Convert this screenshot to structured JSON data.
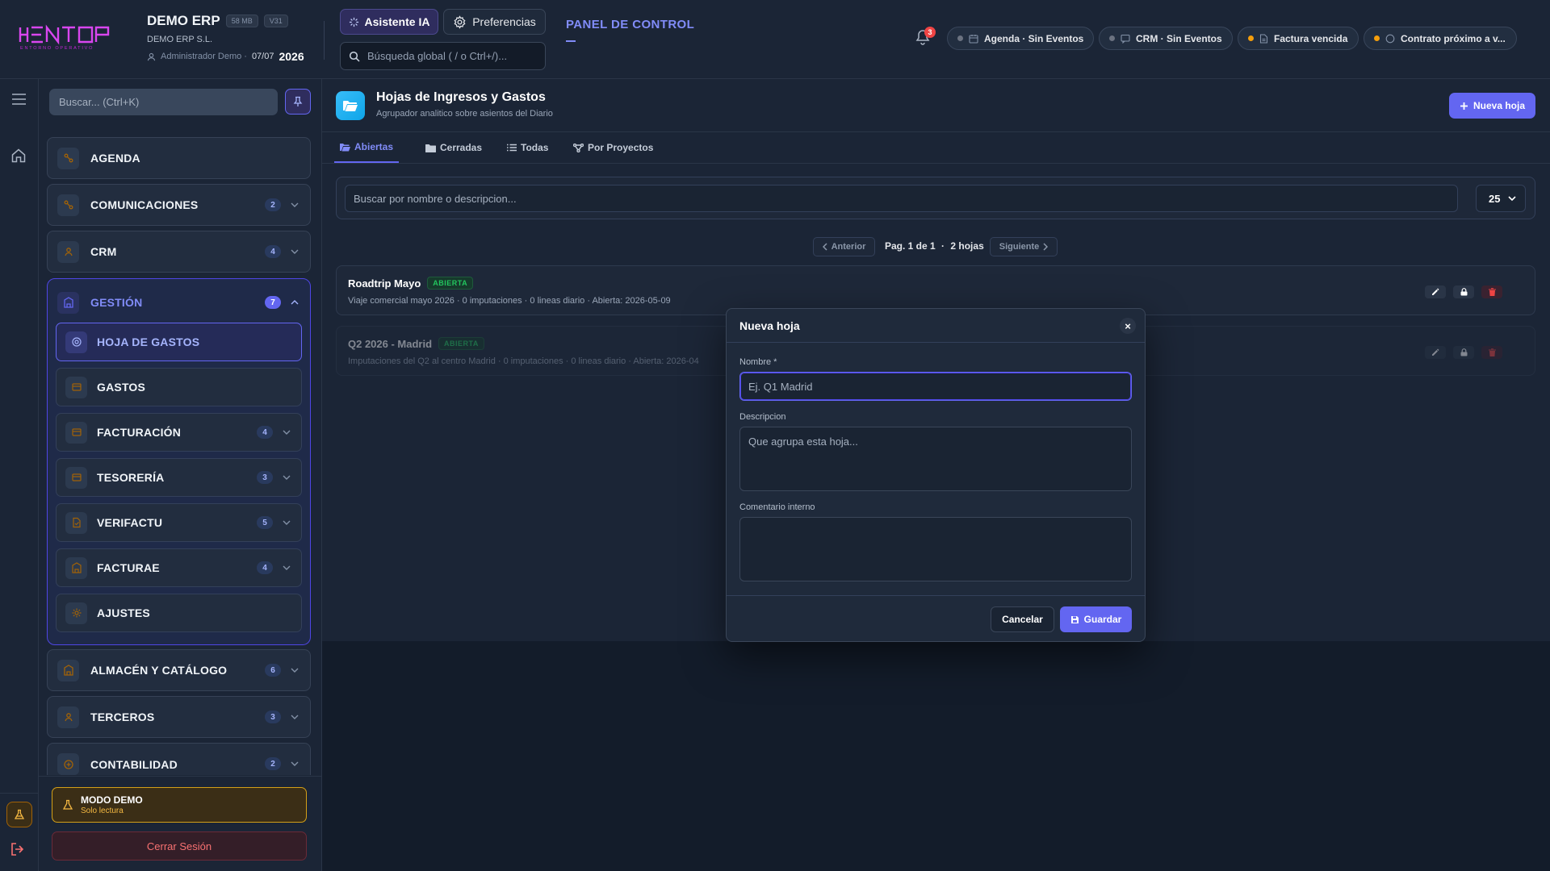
{
  "colors": {
    "accent": "#6366f1",
    "accent_text": "#818cf8",
    "success": "#22c55e",
    "danger": "#ef4444",
    "warning": "#f5b942"
  },
  "header": {
    "logo_text": "KENTOP",
    "logo_tagline": "ENTORNO OPERATIVO",
    "app_title": "DEMO ERP",
    "badge_size": "58 MB",
    "badge_version": "V31",
    "company": "DEMO ERP S.L.",
    "user": "Administrador Demo",
    "date": "07/07",
    "year": "2026",
    "ai_button": "Asistente IA",
    "prefs_button": "Preferencias",
    "search_placeholder": "Búsqueda global ( / o Ctrl+/)...",
    "panel_title": "PANEL DE CONTROL",
    "notification_count": "3",
    "pills": [
      {
        "label": "Agenda · Sin Eventos",
        "icon": "calendar-icon",
        "dot": "#6b7280"
      },
      {
        "label": "CRM · Sin Eventos",
        "icon": "chat-icon",
        "dot": "#6b7280"
      },
      {
        "label": "Factura vencida",
        "icon": "document-icon",
        "dot": "#f59e0b"
      },
      {
        "label": "Contrato próximo a v...",
        "icon": "clock-icon",
        "dot": "#f59e0b"
      }
    ]
  },
  "sidebar": {
    "search_placeholder": "Buscar... (Ctrl+K)",
    "items": [
      {
        "label": "AGENDA",
        "icon": "agenda-icon"
      },
      {
        "label": "COMUNICACIONES",
        "badge": "2",
        "icon": "chat-icon"
      },
      {
        "label": "CRM",
        "badge": "4",
        "icon": "crm-icon"
      },
      {
        "label": "GESTIÓN",
        "badge": "7",
        "icon": "building-icon"
      },
      {
        "label": "ALMACÉN Y CATÁLOGO",
        "badge": "6",
        "icon": "warehouse-icon"
      },
      {
        "label": "TERCEROS",
        "badge": "3",
        "icon": "users-icon"
      },
      {
        "label": "CONTABILIDAD",
        "badge": "2",
        "icon": "calculator-icon"
      }
    ],
    "gestion_children": [
      {
        "label": "HOJA DE GASTOS",
        "icon": "sheet-icon",
        "active": true
      },
      {
        "label": "GASTOS",
        "icon": "expense-icon"
      },
      {
        "label": "FACTURACIÓN",
        "badge": "4",
        "icon": "invoice-icon"
      },
      {
        "label": "TESORERÍA",
        "badge": "3",
        "icon": "treasury-icon"
      },
      {
        "label": "VERIFACTU",
        "badge": "5",
        "icon": "verifactu-icon"
      },
      {
        "label": "FACTURAE",
        "badge": "4",
        "icon": "facturae-icon"
      },
      {
        "label": "AJUSTES",
        "icon": "settings-icon"
      }
    ],
    "demo_title": "MODO DEMO",
    "demo_sub": "Solo lectura",
    "logout": "Cerrar Sesión"
  },
  "main": {
    "title": "Hojas de Ingresos y Gastos",
    "subtitle": "Agrupador analitico sobre asientos del Diario",
    "new_button": "Nueva hoja",
    "tabs": [
      {
        "label": "Abiertas",
        "icon": "folder-open-icon",
        "active": true
      },
      {
        "label": "Cerradas",
        "icon": "folder-icon"
      },
      {
        "label": "Todas",
        "icon": "list-icon"
      },
      {
        "label": "Por Proyectos",
        "icon": "project-icon"
      }
    ],
    "filter_placeholder": "Buscar por nombre o descripcion...",
    "page_size": "25",
    "pager": {
      "prev": "Anterior",
      "next": "Siguiente",
      "page": "Pag. 1 de 1",
      "sep": "·",
      "count": "2 hojas"
    },
    "rows": [
      {
        "name": "Roadtrip Mayo",
        "status": "ABIERTA",
        "desc": "Viaje comercial mayo 2026 · 0 imputaciones · 0 lineas diario · Abierta: 2026-05-09"
      },
      {
        "name": "Q2 2026 - Madrid",
        "status": "ABIERTA",
        "desc": "Imputaciones del Q2 al centro Madrid · 0 imputaciones · 0 lineas diario · Abierta: 2026-04"
      }
    ]
  },
  "modal": {
    "title": "Nueva hoja",
    "close": "×",
    "nombre_label": "Nombre *",
    "nombre_placeholder": "Ej. Q1 Madrid",
    "desc_label": "Descripcion",
    "desc_placeholder": "Que agrupa esta hoja...",
    "comment_label": "Comentario interno",
    "cancel": "Cancelar",
    "save": "Guardar"
  }
}
